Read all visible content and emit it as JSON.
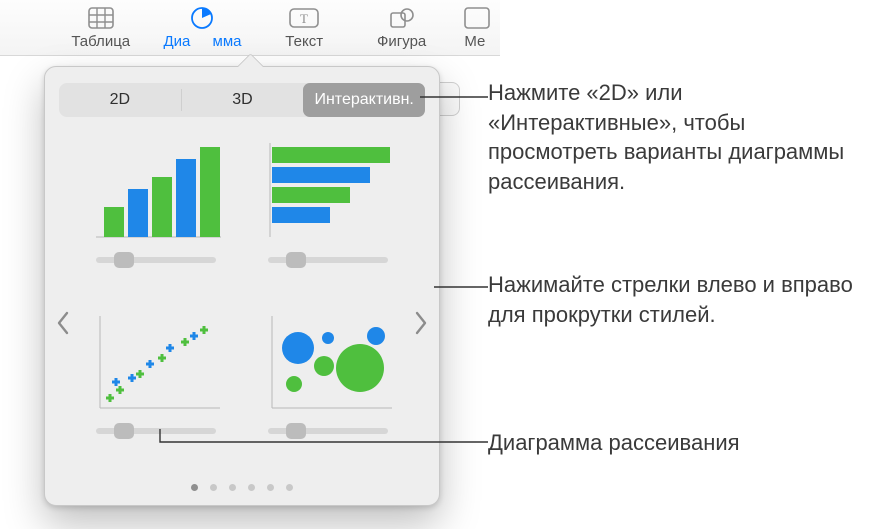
{
  "toolbar": {
    "items": [
      {
        "label": "Таблица"
      },
      {
        "label": "Диаграмма"
      },
      {
        "label": "Текст"
      },
      {
        "label": "Фигура"
      },
      {
        "label": "Ме"
      }
    ]
  },
  "segmented": {
    "tabs": [
      {
        "label": "2D"
      },
      {
        "label": "3D"
      },
      {
        "label": "Интерактивн."
      }
    ]
  },
  "callouts": {
    "tabs": "Нажмите «2D» или «Интерактивные», чтобы просмотреть варианты диаграммы рассеивания.",
    "arrows": "Нажимайте стрелки влево и вправо для прокрутки стилей.",
    "scatter": "Диаграмма рассеивания"
  },
  "pager": {
    "count": 6,
    "current": 1
  },
  "thumbs": [
    {
      "name": "column-chart-thumb"
    },
    {
      "name": "bar-chart-thumb"
    },
    {
      "name": "scatter-chart-thumb"
    },
    {
      "name": "bubble-chart-thumb"
    }
  ],
  "brand": {
    "blue": "#1f87e8",
    "green": "#4fbf3e"
  }
}
